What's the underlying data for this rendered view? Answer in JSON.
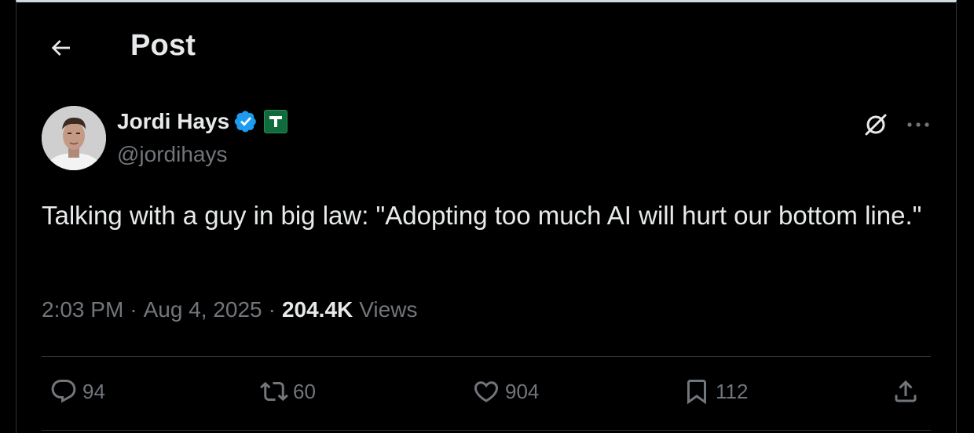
{
  "header": {
    "title": "Post"
  },
  "author": {
    "name": "Jordi Hays",
    "handle": "@jordihays"
  },
  "tweet": {
    "text": "Talking with a guy in big law: \"Adopting too much AI will hurt our bottom line.\""
  },
  "meta": {
    "time": "2:03 PM",
    "separator": "·",
    "date": "Aug 4, 2025",
    "views_count": "204.4K",
    "views_label": "Views"
  },
  "actions": {
    "replies": "94",
    "reposts": "60",
    "likes": "904",
    "bookmarks": "112"
  },
  "colors": {
    "background": "#000000",
    "text": "#e7e9ea",
    "muted": "#71767b",
    "verified": "#1d9bf0",
    "affiliate_badge": "#0f6b3c"
  },
  "icons": [
    "back-arrow-icon",
    "verified-badge-icon",
    "affiliate-badge-icon",
    "grok-icon",
    "more-icon",
    "reply-icon",
    "repost-icon",
    "like-icon",
    "bookmark-icon",
    "share-icon"
  ]
}
